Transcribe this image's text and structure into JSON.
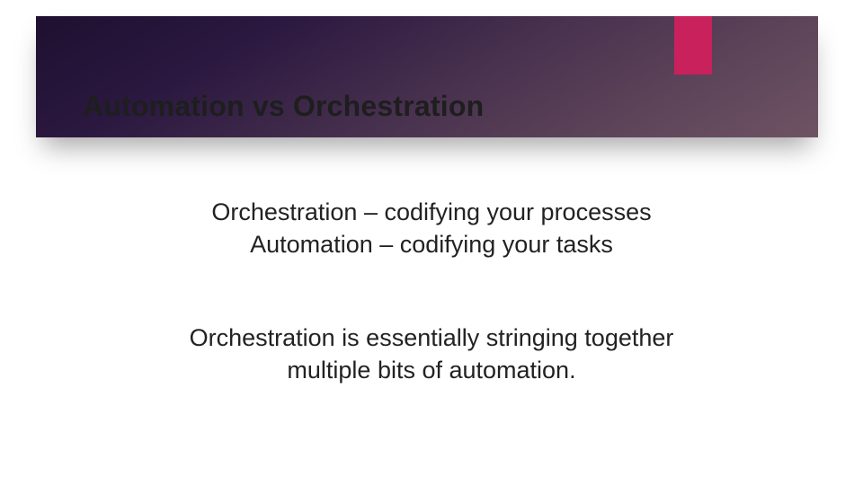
{
  "colors": {
    "accent": "#c9215b",
    "header_gradient_start": "#1e1030",
    "header_gradient_end": "#6e5363",
    "text": "#222222"
  },
  "title": "Automation vs Orchestration",
  "body": {
    "line1": "Orchestration – codifying your processes",
    "line2": "Automation – codifying your tasks",
    "line3": "Orchestration is essentially stringing together",
    "line4": "multiple bits of automation."
  }
}
